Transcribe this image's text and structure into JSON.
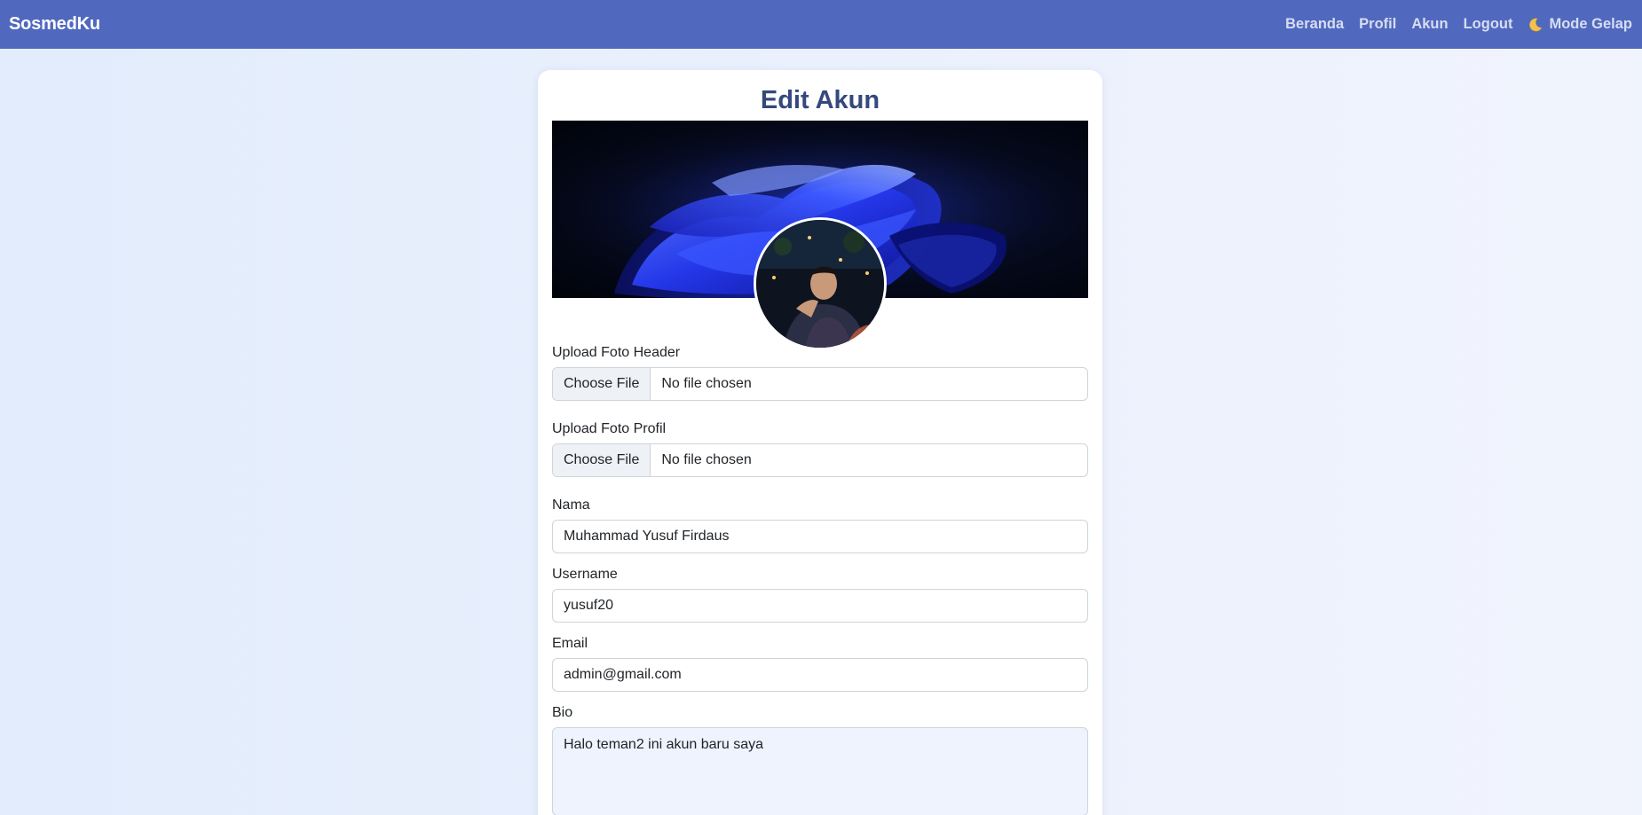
{
  "navbar": {
    "brand": "SosmedKu",
    "links": [
      {
        "label": "Beranda"
      },
      {
        "label": "Profil"
      },
      {
        "label": "Akun"
      },
      {
        "label": "Logout"
      }
    ],
    "dark_mode_label": "Mode Gelap",
    "dark_mode_icon": "moon-icon",
    "background_color": "#5068be"
  },
  "page": {
    "title": "Edit Akun"
  },
  "form": {
    "header_upload": {
      "label": "Upload Foto Header",
      "button": "Choose File",
      "status": "No file chosen"
    },
    "profile_upload": {
      "label": "Upload Foto Profil",
      "button": "Choose File",
      "status": "No file chosen"
    },
    "name": {
      "label": "Nama",
      "value": "Muhammad Yusuf Firdaus"
    },
    "username": {
      "label": "Username",
      "value": "yusuf20"
    },
    "email": {
      "label": "Email",
      "value": "admin@gmail.com"
    },
    "bio": {
      "label": "Bio",
      "value": "Halo teman2 ini akun baru saya"
    }
  },
  "colors": {
    "title": "#34487c",
    "nav_link": "#d7ddf1",
    "bio_background": "#eef3fd"
  }
}
